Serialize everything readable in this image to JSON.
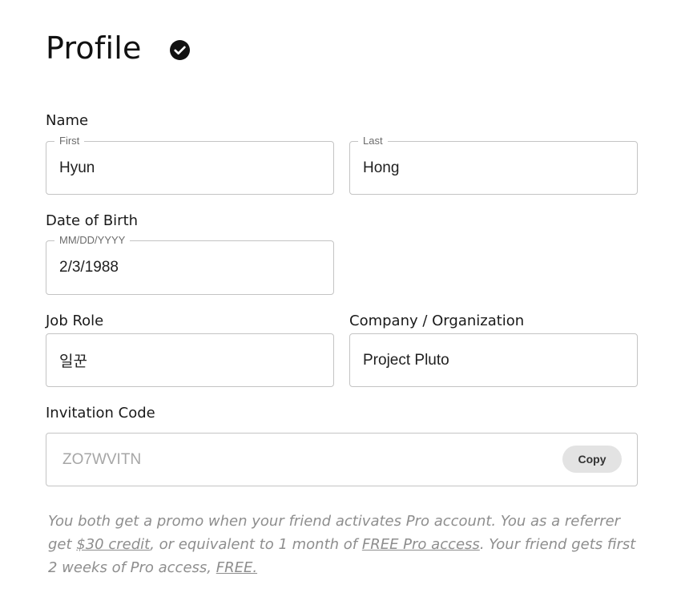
{
  "page": {
    "title": "Profile",
    "verified_icon": "check-circle-icon"
  },
  "name": {
    "label": "Name",
    "first": {
      "legend": "First",
      "value": "Hyun"
    },
    "last": {
      "legend": "Last",
      "value": "Hong"
    }
  },
  "dob": {
    "label": "Date of Birth",
    "legend": "MM/DD/YYYY",
    "value": "2/3/1988"
  },
  "job": {
    "label": "Job Role",
    "value": "일꾼"
  },
  "company": {
    "label": "Company / Organization",
    "value": "Project Pluto"
  },
  "invitation": {
    "label": "Invitation Code",
    "code": "ZO7WVITN",
    "copy_label": "Copy"
  },
  "promo": {
    "text_1": "You both get a promo when your friend activates Pro account. You as a referrer get ",
    "link_credit": "$30 credit",
    "text_2": ", or equivalent to 1 month of ",
    "link_free_pro": "FREE Pro access",
    "text_3": ". Your friend gets first 2 weeks of Pro access, ",
    "link_free": "FREE."
  },
  "colors": {
    "border": "#c4c4c4",
    "muted_text": "#8e8e8e",
    "button_bg": "#e3e3e3"
  }
}
